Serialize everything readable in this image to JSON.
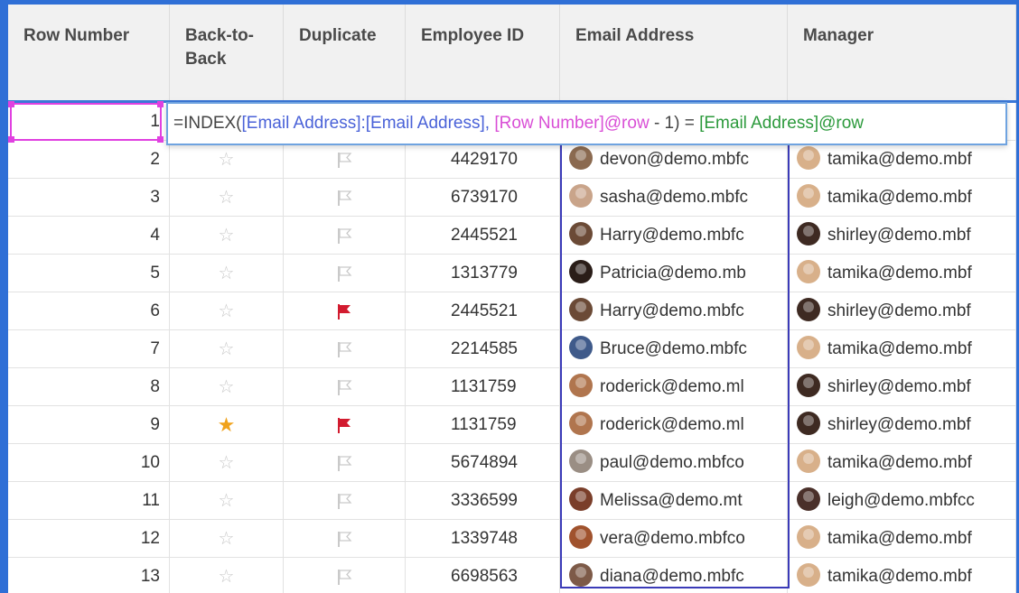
{
  "headers": {
    "row_number": "Row Number",
    "back_to_back_line1": "Back-to-",
    "back_to_back_line2": "Back",
    "duplicate": "Duplicate",
    "employee_id": "Employee ID",
    "email_address": "Email Address",
    "manager": "Manager"
  },
  "formula": {
    "eq_index": "=INDEX(",
    "range": "[Email Address]:[Email Address]",
    "comma": ", ",
    "row_ref": "[Row Number]@row",
    "minus": " - 1)",
    "equals": " = ",
    "email_ref": "[Email Address]@row"
  },
  "rows": [
    {
      "row": "1"
    },
    {
      "row": "2",
      "starred": false,
      "flagged": false,
      "employee_id": "4429170",
      "email": "devon@demo.mbfc",
      "email_avatar_color": "#8b6a50",
      "manager": "tamika@demo.mbf",
      "manager_avatar_color": "#d8b08a"
    },
    {
      "row": "3",
      "starred": false,
      "flagged": false,
      "employee_id": "6739170",
      "email": "sasha@demo.mbfc",
      "email_avatar_color": "#c9a48a",
      "manager": "tamika@demo.mbf",
      "manager_avatar_color": "#d8b08a"
    },
    {
      "row": "4",
      "starred": false,
      "flagged": false,
      "employee_id": "2445521",
      "email": "Harry@demo.mbfc",
      "email_avatar_color": "#6b4a36",
      "manager": "shirley@demo.mbf",
      "manager_avatar_color": "#3e2a22"
    },
    {
      "row": "5",
      "starred": false,
      "flagged": false,
      "employee_id": "1313779",
      "email": "Patricia@demo.mb",
      "email_avatar_color": "#2a1d18",
      "manager": "tamika@demo.mbf",
      "manager_avatar_color": "#d8b08a"
    },
    {
      "row": "6",
      "starred": false,
      "flagged": true,
      "employee_id": "2445521",
      "email": "Harry@demo.mbfc",
      "email_avatar_color": "#6b4a36",
      "manager": "shirley@demo.mbf",
      "manager_avatar_color": "#3e2a22"
    },
    {
      "row": "7",
      "starred": false,
      "flagged": false,
      "employee_id": "2214585",
      "email": "Bruce@demo.mbfc",
      "email_avatar_color": "#3f5a8a",
      "manager": "tamika@demo.mbf",
      "manager_avatar_color": "#d8b08a"
    },
    {
      "row": "8",
      "starred": false,
      "flagged": false,
      "employee_id": "1131759",
      "email": "roderick@demo.ml",
      "email_avatar_color": "#b0754e",
      "manager": "shirley@demo.mbf",
      "manager_avatar_color": "#3e2a22"
    },
    {
      "row": "9",
      "starred": true,
      "flagged": true,
      "employee_id": "1131759",
      "email": "roderick@demo.ml",
      "email_avatar_color": "#b0754e",
      "manager": "shirley@demo.mbf",
      "manager_avatar_color": "#3e2a22"
    },
    {
      "row": "10",
      "starred": false,
      "flagged": false,
      "employee_id": "5674894",
      "email": "paul@demo.mbfco",
      "email_avatar_color": "#9a8e84",
      "manager": "tamika@demo.mbf",
      "manager_avatar_color": "#d8b08a"
    },
    {
      "row": "11",
      "starred": false,
      "flagged": false,
      "employee_id": "3336599",
      "email": "Melissa@demo.mt",
      "email_avatar_color": "#7a3e2a",
      "manager": "leigh@demo.mbfcc",
      "manager_avatar_color": "#4a302a"
    },
    {
      "row": "12",
      "starred": false,
      "flagged": false,
      "employee_id": "1339748",
      "email": "vera@demo.mbfco",
      "email_avatar_color": "#a0522d",
      "manager": "tamika@demo.mbf",
      "manager_avatar_color": "#d8b08a"
    },
    {
      "row": "13",
      "starred": false,
      "flagged": false,
      "employee_id": "6698563",
      "email": "diana@demo.mbfc",
      "email_avatar_color": "#7d5a48",
      "manager": "tamika@demo.mbf",
      "manager_avatar_color": "#d8b08a"
    }
  ],
  "icons": {
    "star_off": "☆",
    "star_on": "★"
  },
  "colors": {
    "frame": "#2f6fd6",
    "flag_on": "#d21b2f",
    "flag_off": "#c9c9c9",
    "star_on": "#f0a21c",
    "active_cell": "#e040e0"
  }
}
